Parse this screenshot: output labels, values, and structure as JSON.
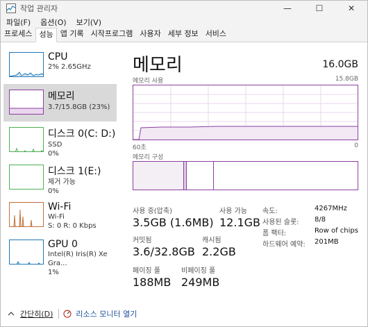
{
  "titlebar": {
    "title": "작업 관리자",
    "minimize": "—",
    "maximize": "☐",
    "close": "✕"
  },
  "menu": {
    "items": [
      "파일(F)",
      "옵션(O)",
      "보기(V)"
    ]
  },
  "tabs": [
    "프로세스",
    "성능",
    "앱 기록",
    "시작프로그램",
    "사용자",
    "세부 정보",
    "서비스"
  ],
  "active_tab": "성능",
  "sidebar": {
    "items": [
      {
        "title": "CPU",
        "sub1": "2% 2.65GHz",
        "sub2": "",
        "sub3": "",
        "color": "#1f77b4"
      },
      {
        "title": "메모리",
        "sub1": "3.7/15.8GB (23%)",
        "sub2": "",
        "sub3": "",
        "color": "#8a3fa0"
      },
      {
        "title": "디스크 0(C: D:)",
        "sub1": "SSD",
        "sub2": "0%",
        "sub3": "",
        "color": "#4caf50"
      },
      {
        "title": "디스크 1(E:)",
        "sub1": "제거 가능",
        "sub2": "0%",
        "sub3": "",
        "color": "#4caf50"
      },
      {
        "title": "Wi-Fi",
        "sub1": "Wi-Fi",
        "sub2": "S: 0 R: 0 Kbps",
        "sub3": "",
        "color": "#c0703a"
      },
      {
        "title": "GPU 0",
        "sub1": "Intel(R) Iris(R) Xe Gra...",
        "sub2": "1%",
        "sub3": "",
        "color": "#1f77b4"
      }
    ]
  },
  "main": {
    "title": "메모리",
    "total": "16.0GB",
    "usage_label": "메모리 사용",
    "usage_max": "15.8GB",
    "time_left": "60초",
    "time_right": "0",
    "composition_label": "메모리 구성",
    "usage_fraction": 0.23,
    "stats": {
      "in_use_label": "사용 중(압축)",
      "in_use_value": "3.5GB (1.6MB)",
      "available_label": "사용 가능",
      "available_value": "12.1GB",
      "committed_label": "커밋됨",
      "committed_value": "3.6/32.8GB",
      "cached_label": "캐시됨",
      "cached_value": "2.2GB",
      "paged_label": "페이징 풀",
      "paged_value": "188MB",
      "nonpaged_label": "비페이징 풀",
      "nonpaged_value": "249MB"
    },
    "details": {
      "speed_label": "속도:",
      "speed_value": "4267MHz",
      "slots_label": "사용된 슬롯:",
      "slots_value": "8/8",
      "form_label": "폼 팩터:",
      "form_value": "Row of chips",
      "reserved_label": "하드웨어 예약:",
      "reserved_value": "201MB"
    }
  },
  "footer": {
    "collapse_label": "간단히(D)",
    "monitor_label": "리소스 모니터 열기"
  }
}
